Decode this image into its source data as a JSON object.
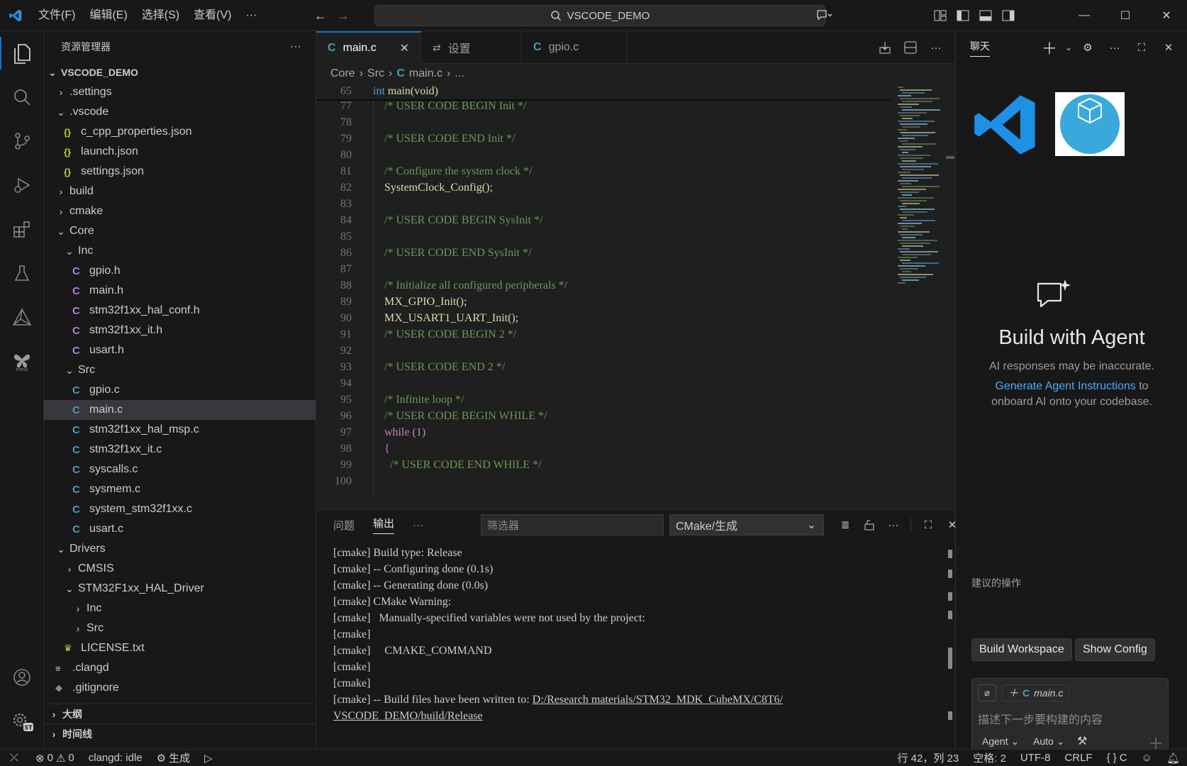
{
  "menus": [
    "文件(F)",
    "编辑(E)",
    "选择(S)",
    "查看(V)",
    "···"
  ],
  "search": {
    "label": "VSCODE_DEMO"
  },
  "sidebar": {
    "title": "资源管理器",
    "root": "VSCODE_DEMO",
    "tree": [
      {
        "label": ".settings",
        "depth": 1,
        "kind": "folder-closed"
      },
      {
        "label": ".vscode",
        "depth": 1,
        "kind": "folder-open"
      },
      {
        "label": "c_cpp_properties.json",
        "depth": 2,
        "kind": "json"
      },
      {
        "label": "launch.json",
        "depth": 2,
        "kind": "json"
      },
      {
        "label": "settings.json",
        "depth": 2,
        "kind": "json"
      },
      {
        "label": "build",
        "depth": 1,
        "kind": "folder-closed"
      },
      {
        "label": "cmake",
        "depth": 1,
        "kind": "folder-closed"
      },
      {
        "label": "Core",
        "depth": 1,
        "kind": "folder-open"
      },
      {
        "label": "Inc",
        "depth": 2,
        "kind": "folder-open"
      },
      {
        "label": "gpio.h",
        "depth": 3,
        "kind": "h"
      },
      {
        "label": "main.h",
        "depth": 3,
        "kind": "h"
      },
      {
        "label": "stm32f1xx_hal_conf.h",
        "depth": 3,
        "kind": "h"
      },
      {
        "label": "stm32f1xx_it.h",
        "depth": 3,
        "kind": "h"
      },
      {
        "label": "usart.h",
        "depth": 3,
        "kind": "h"
      },
      {
        "label": "Src",
        "depth": 2,
        "kind": "folder-open"
      },
      {
        "label": "gpio.c",
        "depth": 3,
        "kind": "c"
      },
      {
        "label": "main.c",
        "depth": 3,
        "kind": "c",
        "selected": true
      },
      {
        "label": "stm32f1xx_hal_msp.c",
        "depth": 3,
        "kind": "c"
      },
      {
        "label": "stm32f1xx_it.c",
        "depth": 3,
        "kind": "c"
      },
      {
        "label": "syscalls.c",
        "depth": 3,
        "kind": "c"
      },
      {
        "label": "sysmem.c",
        "depth": 3,
        "kind": "c"
      },
      {
        "label": "system_stm32f1xx.c",
        "depth": 3,
        "kind": "c"
      },
      {
        "label": "usart.c",
        "depth": 3,
        "kind": "c"
      },
      {
        "label": "Drivers",
        "depth": 1,
        "kind": "folder-open"
      },
      {
        "label": "CMSIS",
        "depth": 2,
        "kind": "folder-closed"
      },
      {
        "label": "STM32F1xx_HAL_Driver",
        "depth": 2,
        "kind": "folder-open"
      },
      {
        "label": "Inc",
        "depth": 3,
        "kind": "folder-closed"
      },
      {
        "label": "Src",
        "depth": 3,
        "kind": "folder-closed"
      },
      {
        "label": "LICENSE.txt",
        "depth": 2,
        "kind": "license"
      },
      {
        "label": ".clangd",
        "depth": 1,
        "kind": "text"
      },
      {
        "label": ".gitignore",
        "depth": 1,
        "kind": "git"
      }
    ],
    "sections": [
      "大纲",
      "时间线"
    ]
  },
  "tabs": [
    {
      "label": "main.c",
      "icon": "C",
      "active": true
    },
    {
      "label": "设置",
      "icon": "settings-icon",
      "active": false
    },
    {
      "label": "gpio.c",
      "icon": "C",
      "active": false
    }
  ],
  "breadcrumb": [
    "Core",
    "Src",
    "main.c",
    "..."
  ],
  "code": {
    "sticky": {
      "ln": "65",
      "text": "int main(void)"
    },
    "lines": [
      {
        "ln": "77",
        "text": "/* USER CODE BEGIN Init */",
        "cls": "cm"
      },
      {
        "ln": "78",
        "text": "",
        "cls": "pl"
      },
      {
        "ln": "79",
        "text": "/* USER CODE END Init */",
        "cls": "cm"
      },
      {
        "ln": "80",
        "text": "",
        "cls": "pl"
      },
      {
        "ln": "81",
        "text": "/* Configure the system clock */",
        "cls": "cm"
      },
      {
        "ln": "82",
        "text": "SystemClock_Config();",
        "cls": "fn"
      },
      {
        "ln": "83",
        "text": "",
        "cls": "pl"
      },
      {
        "ln": "84",
        "text": "/* USER CODE BEGIN SysInit */",
        "cls": "cm"
      },
      {
        "ln": "85",
        "text": "",
        "cls": "pl"
      },
      {
        "ln": "86",
        "text": "/* USER CODE END SysInit */",
        "cls": "cm"
      },
      {
        "ln": "87",
        "text": "",
        "cls": "pl"
      },
      {
        "ln": "88",
        "text": "/* Initialize all configured peripherals */",
        "cls": "cm"
      },
      {
        "ln": "89",
        "text": "MX_GPIO_Init();",
        "cls": "fn"
      },
      {
        "ln": "90",
        "text": "MX_USART1_UART_Init();",
        "cls": "fn"
      },
      {
        "ln": "91",
        "text": "/* USER CODE BEGIN 2 */",
        "cls": "cm"
      },
      {
        "ln": "92",
        "text": "",
        "cls": "pl"
      },
      {
        "ln": "93",
        "text": "/* USER CODE END 2 */",
        "cls": "cm"
      },
      {
        "ln": "94",
        "text": "",
        "cls": "pl"
      },
      {
        "ln": "95",
        "text": "/* Infinite loop */",
        "cls": "cm"
      },
      {
        "ln": "96",
        "text": "/* USER CODE BEGIN WHILE */",
        "cls": "cm"
      },
      {
        "ln": "97",
        "text": "while (1)",
        "cls": "kw2"
      },
      {
        "ln": "98",
        "text": "{",
        "cls": "pn"
      },
      {
        "ln": "99",
        "text": "  /* USER CODE END WHILE */",
        "cls": "cm"
      },
      {
        "ln": "100",
        "text": "",
        "cls": "pl"
      }
    ]
  },
  "panel": {
    "tabs": [
      "问题",
      "输出",
      "···"
    ],
    "filter_placeholder": "筛选器",
    "output_channel": "CMake/生成",
    "lines": [
      "[cmake] Build type: Release",
      "[cmake] -- Configuring done (0.1s)",
      "[cmake] -- Generating done (0.0s)",
      "[cmake] CMake Warning:",
      "[cmake]   Manually-specified variables were not used by the project:",
      "[cmake]",
      "[cmake]     CMAKE_COMMAND",
      "[cmake]",
      "[cmake]",
      "[cmake] -- Build files have been written to: "
    ],
    "link_part1": "D:/Research materials/STM32_MDK_CubeMX/C8T6/",
    "link_part2": "VSCODE_DEMO/build/Release"
  },
  "chat": {
    "title": "聊天",
    "heading": "Build with Agent",
    "disclaimer": "AI responses may be inaccurate.",
    "link": "Generate Agent Instructions",
    "link_suffix": " to",
    "line2": "onboard AI onto your codebase.",
    "suggest_title": "建议的操作",
    "suggestions": [
      "Build Workspace",
      "Show Config"
    ],
    "context_file": "main.c",
    "input_placeholder": "描述下一步要构建的内容",
    "mode": "Agent",
    "model": "Auto",
    "cube_logo_text": "STM32 Cube"
  },
  "status": {
    "errors": "0",
    "warnings": "0",
    "clangd": "clangd: idle",
    "build": "生成",
    "position": "行 42，列 23",
    "spaces": "空格: 2",
    "encoding": "UTF-8",
    "eol": "CRLF",
    "lang": "C"
  },
  "colors": {
    "accent": "#0078d4",
    "link": "#4daafc",
    "comment": "#6a9955",
    "function": "#dcdcaa"
  }
}
